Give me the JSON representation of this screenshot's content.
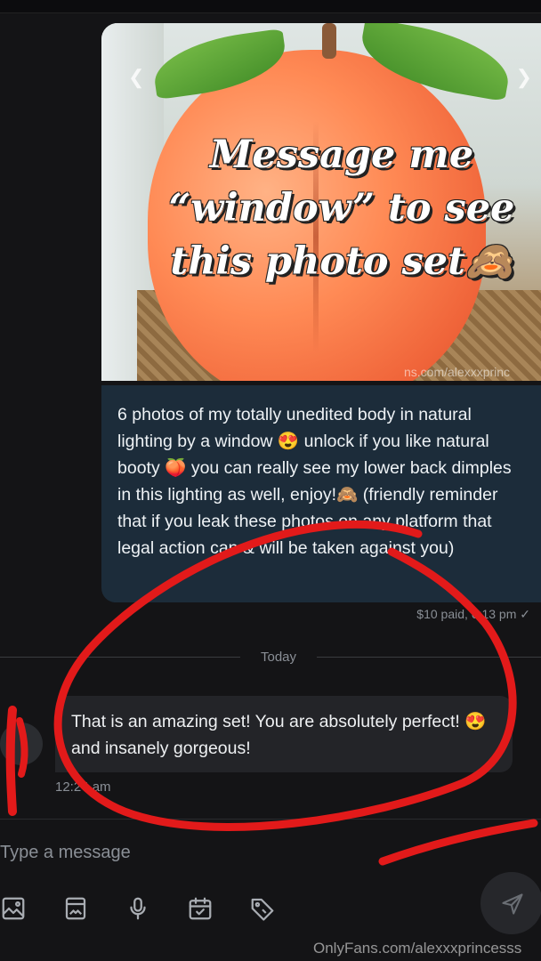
{
  "photo_post": {
    "overlay_text": "Message me “window” to see this photo set🙈",
    "watermark": "ns.com/alexxxprinc"
  },
  "message_out": {
    "text": "6 photos of my totally unedited body in natural lighting by a window 😍 unlock if you like natural booty 🍑 you can really see my lower back dimples in this lighting as well, enjoy!🙈 (friendly reminder that if you leak these photos on any platform that legal action can & will be taken against you)",
    "meta": "$10 paid, 6:13 pm"
  },
  "date_divider": "Today",
  "message_in": {
    "text": "That is an amazing set! You are absolutely perfect! 😍 and insanely gorgeous!",
    "time": "12:24 am"
  },
  "composer": {
    "placeholder": "Type a message"
  },
  "toolbar": {
    "icons": [
      "image-icon",
      "gallery-icon",
      "microphone-icon",
      "calendar-check-icon",
      "price-tag-icon"
    ],
    "send_icon": "send-icon"
  },
  "footer_watermark": "OnlyFans.com/alexxxprincesss",
  "colors": {
    "background": "#141416",
    "outgoing_bubble": "#1c2c3a",
    "incoming_bubble": "#232428",
    "annotation": "#e21a1a"
  }
}
